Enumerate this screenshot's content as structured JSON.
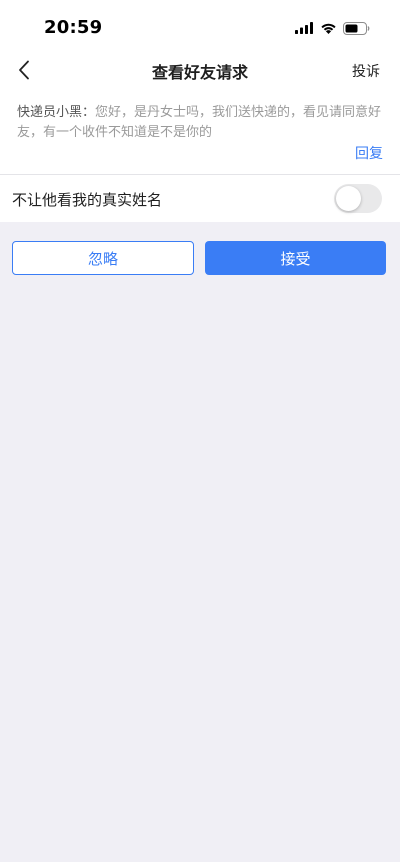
{
  "status_bar": {
    "time": "20:59",
    "icons": [
      "signal-icon",
      "wifi-icon",
      "battery-icon"
    ]
  },
  "nav": {
    "back_icon": "chevron-left-icon",
    "title": "查看好友请求",
    "action": "投诉"
  },
  "request": {
    "sender": "快递员小黑：",
    "message": "您好，是丹女士吗，我们送快递的，看见请同意好友，有一个收件不知道是不是你的",
    "reply": "回复"
  },
  "privacy": {
    "label": "不让他看我的真实姓名",
    "enabled": false
  },
  "actions": {
    "ignore": "忽略",
    "accept": "接受"
  },
  "colors": {
    "accent": "#3a7df5",
    "background": "#f0eff5"
  }
}
